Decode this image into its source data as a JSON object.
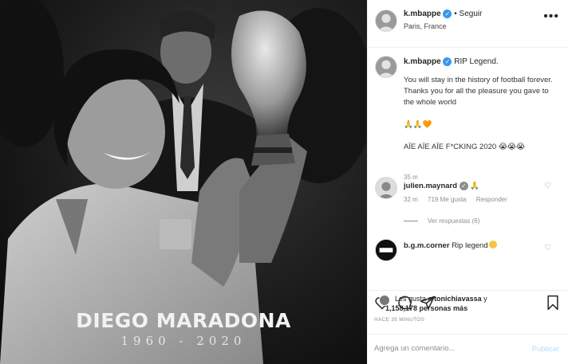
{
  "image": {
    "name_text": "DIEGO MARADONA",
    "years_text": "1960 - 2020"
  },
  "header": {
    "username": "k.mbappe",
    "follow_label": "Seguir",
    "location": "Paris, France",
    "more_icon": "more-dots-icon"
  },
  "caption": {
    "username": "k.mbappe",
    "headline": "RIP Legend.",
    "body": "You will stay in the history of football forever. Thanks you for all the pleasure you gave to the whole world",
    "emojis_line1": "🙏🙏🧡",
    "line2": "AÏE AÏE AÏE F*CKING 2020",
    "emojis_line2": "😭😭😭",
    "time": "35 m"
  },
  "comments": [
    {
      "username": "julien.maynard",
      "text": "🙏",
      "time": "32 m",
      "likes": "719 Me gusta",
      "reply_label": "Responder",
      "replies_label": "Ver respuestas (6)"
    },
    {
      "username": "b.g.m.corner",
      "text": "Rip legend"
    }
  ],
  "actions": {
    "like_icon": "heart-icon",
    "comment_icon": "comment-icon",
    "share_icon": "share-icon",
    "save_icon": "bookmark-icon"
  },
  "likes": {
    "line1_prefix": "Les gusta a",
    "line1_user": "tonichiavassa",
    "line1_suffix": "y",
    "count": "1,158,178 personas más"
  },
  "timestamp": "HACE 35 MINUTOS",
  "comment_box": {
    "placeholder": "Agrega un comentario...",
    "publish_label": "Publicar"
  },
  "colors": {
    "accent": "#3897f0",
    "publish_disabled": "#b2dffc"
  }
}
